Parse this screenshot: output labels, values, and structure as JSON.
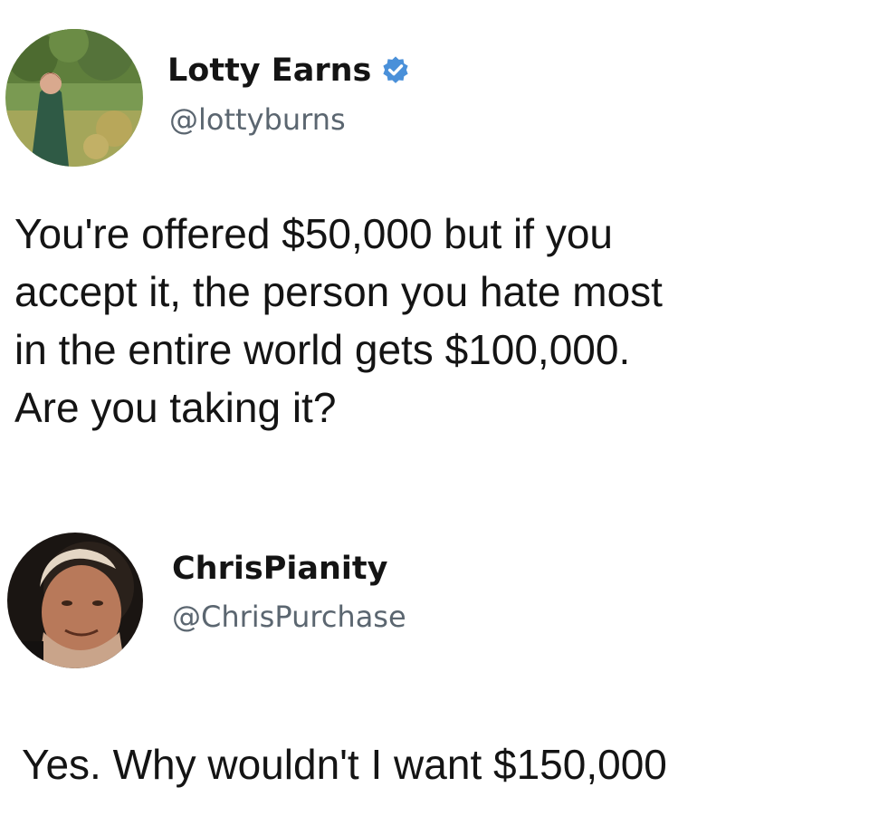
{
  "tweets": [
    {
      "author": {
        "display_name": "Lotty Earns",
        "handle": "@lottyburns",
        "verified": true,
        "avatar_icon": "woman-in-field-avatar"
      },
      "text": "You're offered $50,000 but if you\naccept it, the person you hate most\nin the entire world gets $100,000.\nAre you taking it?"
    },
    {
      "author": {
        "display_name": "ChrisPianity",
        "handle": "@ChrisPurchase",
        "verified": false,
        "avatar_icon": "man-portrait-avatar"
      },
      "text": "Yes. Why wouldn't I want $150,000"
    }
  ],
  "colors": {
    "text": "#141414",
    "handle": "#5b6670",
    "verified_badge": "#4a90d9"
  }
}
